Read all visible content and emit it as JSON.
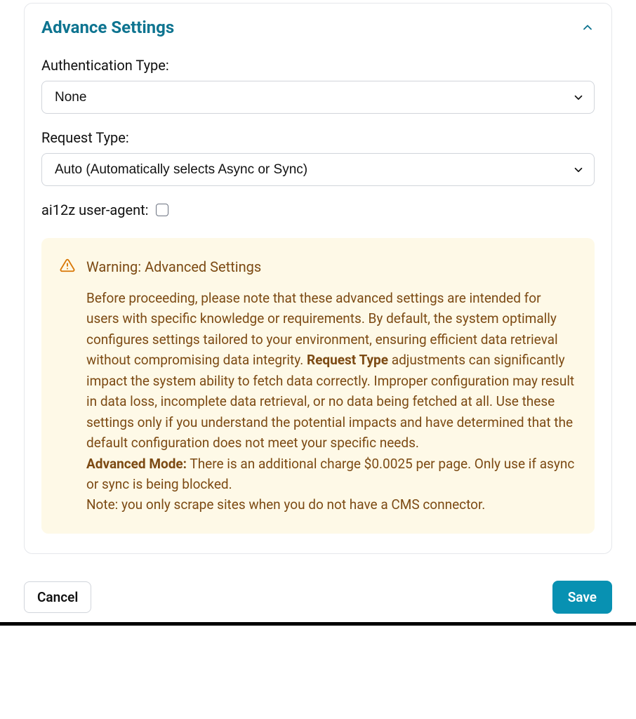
{
  "card": {
    "title": "Advance Settings"
  },
  "fields": {
    "auth": {
      "label": "Authentication Type:",
      "value": "None"
    },
    "request": {
      "label": "Request Type:",
      "value": "Auto (Automatically selects Async or Sync)"
    },
    "useragent": {
      "label": "ai12z user-agent:"
    }
  },
  "warning": {
    "title": "Warning: Advanced Settings",
    "p1": "Before proceeding, please note that these advanced settings are intended for users with specific knowledge or requirements. By default, the system optimally configures settings tailored to your environment, ensuring efficient data retrieval without compromising data integrity. ",
    "p2_bold": "Request Type",
    "p2_rest": " adjustments can significantly impact the system ability to fetch data correctly. Improper configuration may result in data loss, incomplete data retrieval, or no data being fetched at all. Use these settings only if you understand the potential impacts and have determined that the default configuration does not meet your specific needs.",
    "p3_bold": "Advanced Mode:",
    "p3_rest": " There is an additional charge $0.0025 per page. Only use if async or sync is being blocked.",
    "p4": "Note: you only scrape sites when you do not have a CMS connector."
  },
  "actions": {
    "cancel": "Cancel",
    "save": "Save"
  }
}
